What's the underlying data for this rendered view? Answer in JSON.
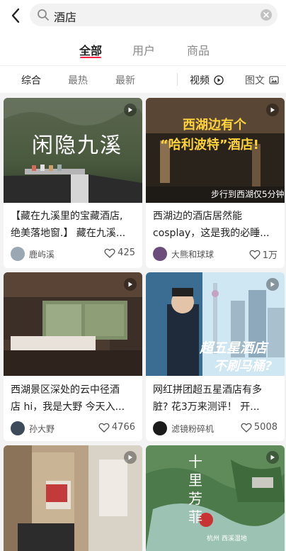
{
  "search": {
    "query": "酒店"
  },
  "tabs": [
    {
      "label": "全部"
    },
    {
      "label": "用户"
    },
    {
      "label": "商品"
    }
  ],
  "filters": {
    "sort": [
      "综合",
      "最热",
      "最新"
    ],
    "video_label": "视频",
    "image_label": "图文"
  },
  "colors": {
    "accent": "#ff2442",
    "muted": "#8a8a8a"
  },
  "cards": [
    {
      "title_line1": "【藏在九溪里的宝藏酒店,",
      "title_line2": "绝美落地窗.】 藏在九溪...",
      "author": "鹿屿溪",
      "likes": "425",
      "thumb_text": "闲隐九溪",
      "icon": "play-icon"
    },
    {
      "title_line1": "西湖边的酒店居然能",
      "title_line2": "cosplay，这是我的必睡...",
      "author": "大熊和球球",
      "likes": "1万",
      "thumb_line1": "西湖边有个",
      "thumb_line2": "“哈利波特”酒店!",
      "thumb_line3": "步行到西湖仅5分钟",
      "icon": "play-icon"
    },
    {
      "title_line1": "西湖景区深处的云中径酒",
      "title_line2": "店 hi，我是大野 今天入...",
      "author": "孙大野",
      "likes": "4766",
      "icon": "play-icon"
    },
    {
      "title_line1": "网红拼团超五星酒店有多",
      "title_line2": "脏? 花3万来测评！ 开...",
      "author": "滤镜粉碎机",
      "likes": "5008",
      "thumb_line1": "超五星酒店",
      "thumb_line2": "不刷马桶?",
      "icon": "play-icon"
    },
    {
      "icon": "play-icon"
    },
    {
      "thumb_vertical": "十里芳菲",
      "thumb_caption": "杭州 西溪湿地",
      "icon": "play-icon"
    }
  ]
}
